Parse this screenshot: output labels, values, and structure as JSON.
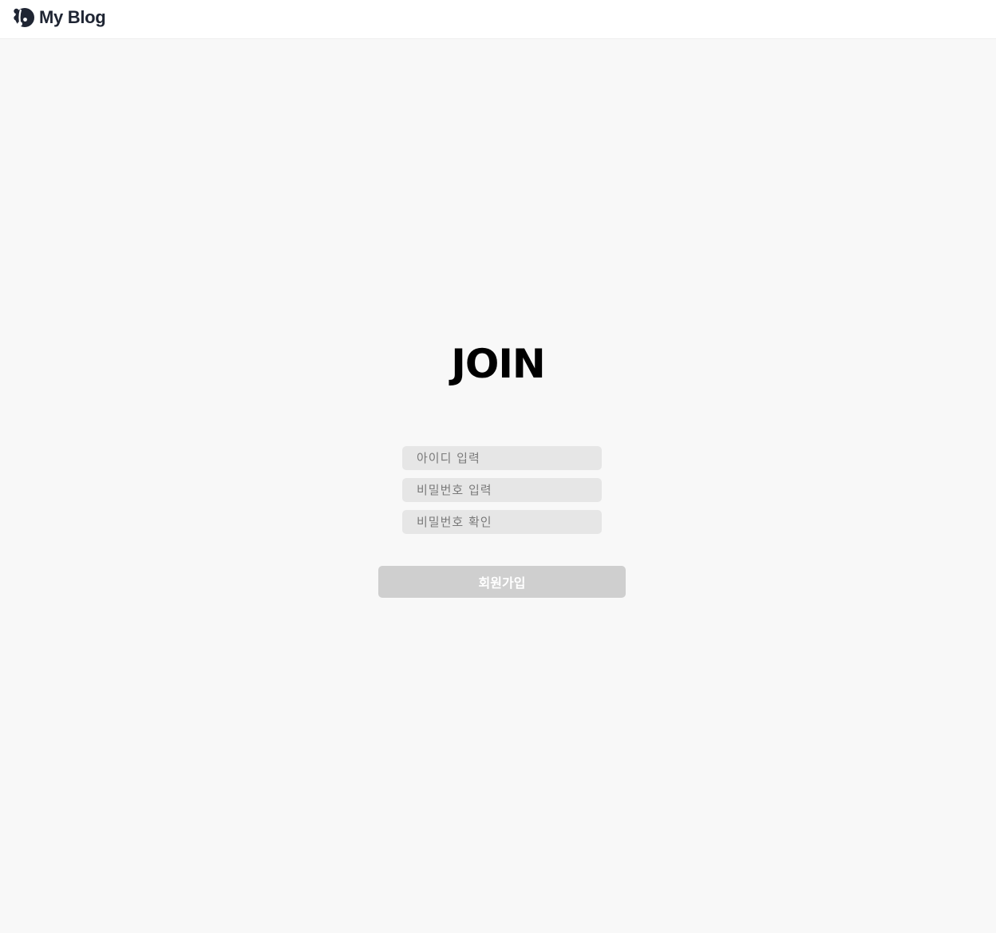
{
  "header": {
    "brand_name": "My Blog",
    "logo_icon": "blog-logo-icon"
  },
  "join": {
    "title": "JOIN",
    "fields": [
      {
        "placeholder": "아이디 입력",
        "value": ""
      },
      {
        "placeholder": "비밀번호 입력",
        "value": ""
      },
      {
        "placeholder": "비밀번호 확인",
        "value": ""
      }
    ],
    "submit_label": "회원가입"
  },
  "colors": {
    "background": "#f8f8f8",
    "header_bg": "#ffffff",
    "brand_text": "#1f2533",
    "field_bg": "#e6e6e6",
    "button_bg_disabled": "#cfcfcf"
  }
}
